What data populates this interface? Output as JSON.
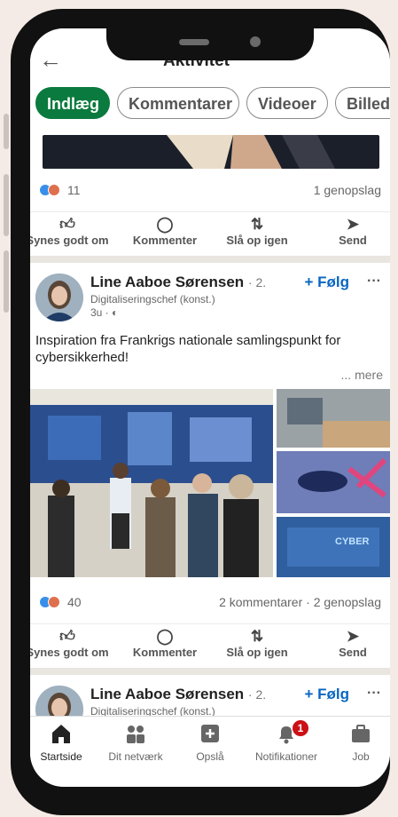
{
  "header": {
    "title": "Aktivitet"
  },
  "chips": [
    "Indlæg",
    "Kommentarer",
    "Videoer",
    "Billed"
  ],
  "post1": {
    "reaction_count": "11",
    "reposts": "1 genopslag"
  },
  "actions": {
    "like": "Synes godt om",
    "comment": "Kommenter",
    "repost": "Slå op igen",
    "send": "Send"
  },
  "post2": {
    "author": "Line Aaboe Sørensen",
    "degree": "· 2.",
    "headline": "Digitaliseringschef (konst.)",
    "time": "3u ·",
    "follow": "+ Følg",
    "text": "Inspiration fra Frankrigs nationale samlingspunkt for cybersikkerhed!",
    "more": "... mere",
    "reaction_count": "40",
    "comments": "2 kommentarer",
    "reposts": "2 genopslag",
    "photo_caption": "CYBER"
  },
  "post3": {
    "author": "Line Aaboe Sørensen",
    "degree": "· 2.",
    "headline": "Digitaliseringschef (konst.)",
    "follow": "+ Følg"
  },
  "nav": {
    "home": "Startside",
    "network": "Dit netværk",
    "post": "Opslå",
    "notifications": "Notifikationer",
    "notification_count": "1",
    "jobs": "Job"
  },
  "colors": {
    "accent": "#0b7a3e",
    "link": "#0a66c2",
    "badge": "#cc1016"
  }
}
